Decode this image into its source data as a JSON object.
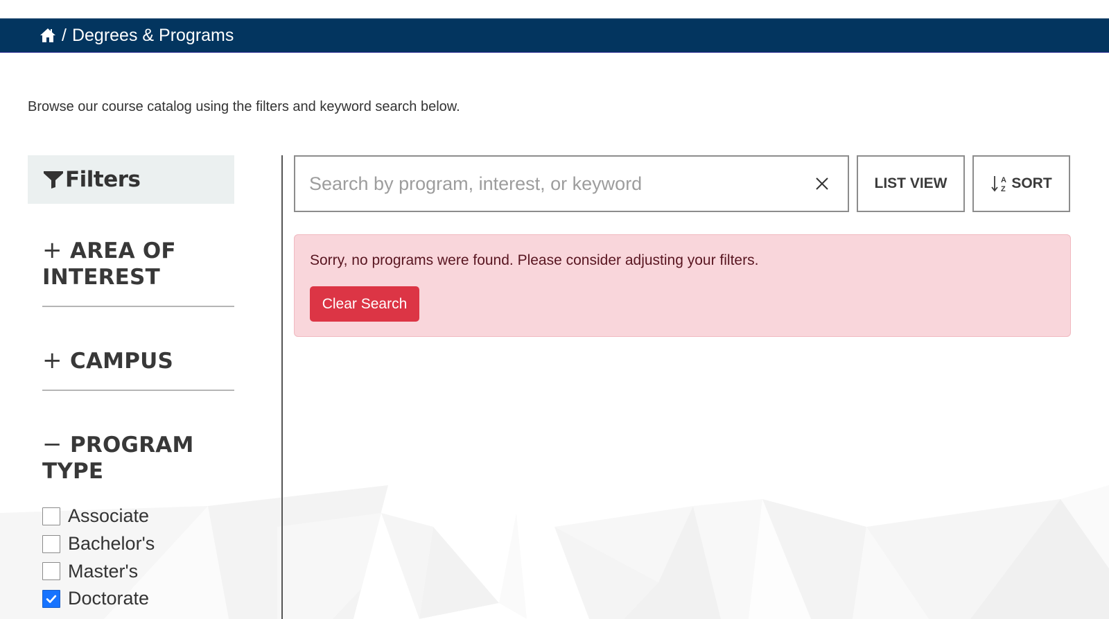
{
  "header": {
    "home_icon": "home-icon",
    "separator": "/",
    "current_page": "Degrees & Programs",
    "background_color": "#03355f"
  },
  "intro_text": "Browse our course catalog using the filters and keyword search below.",
  "sidebar": {
    "title": "Filters",
    "title_icon": "funnel-icon",
    "groups": [
      {
        "toggle": "+",
        "label": "AREA OF INTEREST",
        "expanded": false
      },
      {
        "toggle": "+",
        "label": "CAMPUS",
        "expanded": false
      },
      {
        "toggle": "−",
        "label": "PROGRAM TYPE",
        "expanded": true,
        "options": [
          {
            "label": "Associate",
            "checked": false
          },
          {
            "label": "Bachelor's",
            "checked": false
          },
          {
            "label": "Master's",
            "checked": false
          },
          {
            "label": "Doctorate",
            "checked": true
          }
        ]
      }
    ]
  },
  "search": {
    "placeholder": "Search by program, interest, or keyword",
    "value": "",
    "clear_icon": "close-icon"
  },
  "toolbar": {
    "list_view_label": "LIST VIEW",
    "sort_label": "SORT",
    "sort_icon": "sort-alpha-down-icon"
  },
  "alert": {
    "message": "Sorry, no programs were found. Please consider adjusting your filters.",
    "button_label": "Clear Search",
    "background_color": "#f9d6db",
    "button_color": "#dc3545"
  }
}
